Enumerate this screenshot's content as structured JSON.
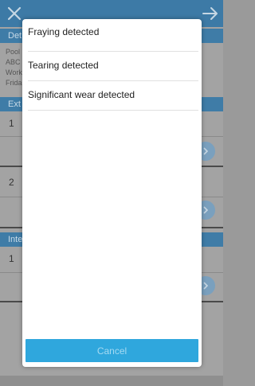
{
  "background": {
    "header_details": "Det",
    "details_lines": [
      "Pool",
      "ABC",
      "Work",
      "Frida"
    ],
    "header_external": "Ext",
    "header_internal": "Inte",
    "rows": [
      "1",
      "2",
      "1"
    ]
  },
  "modal": {
    "options": [
      {
        "label": "Fraying detected"
      },
      {
        "label": "Tearing detected"
      },
      {
        "label": "Significant wear detected"
      }
    ],
    "cancel_label": "Cancel"
  },
  "colors": {
    "accent": "#2fa7dd",
    "topbar": "#3d7aa6"
  }
}
